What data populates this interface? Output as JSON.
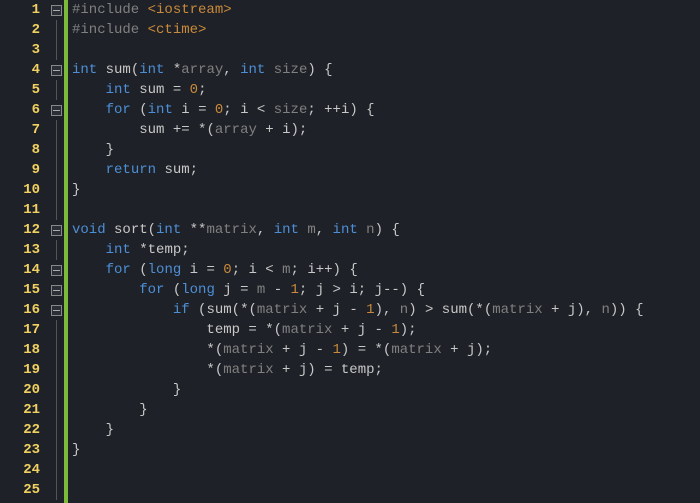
{
  "lines": {
    "l1": {
      "n": "1",
      "fold": true,
      "tokens": [
        [
          "pre",
          "#include "
        ],
        [
          "str",
          "<iostream>"
        ]
      ]
    },
    "l2": {
      "n": "2",
      "fold": false,
      "tokens": [
        [
          "pre",
          "#include "
        ],
        [
          "str",
          "<ctime>"
        ]
      ]
    },
    "l3": {
      "n": "3",
      "fold": false,
      "tokens": []
    },
    "l4": {
      "n": "4",
      "fold": true,
      "tokens": [
        [
          "typ",
          "int"
        ],
        [
          "op",
          " "
        ],
        [
          "id",
          "sum"
        ],
        [
          "op",
          "("
        ],
        [
          "typ",
          "int"
        ],
        [
          "op",
          " *"
        ],
        [
          "var",
          "array"
        ],
        [
          "op",
          ", "
        ],
        [
          "typ",
          "int"
        ],
        [
          "op",
          " "
        ],
        [
          "var",
          "size"
        ],
        [
          "op",
          ") {"
        ]
      ]
    },
    "l5": {
      "n": "5",
      "fold": false,
      "tokens": [
        [
          "op",
          "    "
        ],
        [
          "typ",
          "int"
        ],
        [
          "op",
          " "
        ],
        [
          "id",
          "sum"
        ],
        [
          "op",
          " = "
        ],
        [
          "num",
          "0"
        ],
        [
          "op",
          ";"
        ]
      ]
    },
    "l6": {
      "n": "6",
      "fold": true,
      "tokens": [
        [
          "op",
          "    "
        ],
        [
          "kw",
          "for"
        ],
        [
          "op",
          " ("
        ],
        [
          "typ",
          "int"
        ],
        [
          "op",
          " "
        ],
        [
          "id",
          "i"
        ],
        [
          "op",
          " = "
        ],
        [
          "num",
          "0"
        ],
        [
          "op",
          "; "
        ],
        [
          "id",
          "i"
        ],
        [
          "op",
          " < "
        ],
        [
          "var",
          "size"
        ],
        [
          "op",
          "; ++"
        ],
        [
          "id",
          "i"
        ],
        [
          "op",
          ") {"
        ]
      ]
    },
    "l7": {
      "n": "7",
      "fold": false,
      "tokens": [
        [
          "op",
          "        "
        ],
        [
          "id",
          "sum"
        ],
        [
          "op",
          " += *("
        ],
        [
          "var",
          "array"
        ],
        [
          "op",
          " + "
        ],
        [
          "id",
          "i"
        ],
        [
          "op",
          ");"
        ]
      ]
    },
    "l8": {
      "n": "8",
      "fold": false,
      "tokens": [
        [
          "op",
          "    }"
        ]
      ]
    },
    "l9": {
      "n": "9",
      "fold": false,
      "tokens": [
        [
          "op",
          "    "
        ],
        [
          "kw",
          "return"
        ],
        [
          "op",
          " "
        ],
        [
          "id",
          "sum"
        ],
        [
          "op",
          ";"
        ]
      ]
    },
    "l10": {
      "n": "10",
      "fold": false,
      "tokens": [
        [
          "op",
          "}"
        ]
      ]
    },
    "l11": {
      "n": "11",
      "fold": false,
      "tokens": []
    },
    "l12": {
      "n": "12",
      "fold": true,
      "tokens": [
        [
          "typ",
          "void"
        ],
        [
          "op",
          " "
        ],
        [
          "id",
          "sort"
        ],
        [
          "op",
          "("
        ],
        [
          "typ",
          "int"
        ],
        [
          "op",
          " **"
        ],
        [
          "var",
          "matrix"
        ],
        [
          "op",
          ", "
        ],
        [
          "typ",
          "int"
        ],
        [
          "op",
          " "
        ],
        [
          "var",
          "m"
        ],
        [
          "op",
          ", "
        ],
        [
          "typ",
          "int"
        ],
        [
          "op",
          " "
        ],
        [
          "var",
          "n"
        ],
        [
          "op",
          ") {"
        ]
      ]
    },
    "l13": {
      "n": "13",
      "fold": false,
      "tokens": [
        [
          "op",
          "    "
        ],
        [
          "typ",
          "int"
        ],
        [
          "op",
          " *"
        ],
        [
          "id",
          "temp"
        ],
        [
          "op",
          ";"
        ]
      ]
    },
    "l14": {
      "n": "14",
      "fold": true,
      "tokens": [
        [
          "op",
          "    "
        ],
        [
          "kw",
          "for"
        ],
        [
          "op",
          " ("
        ],
        [
          "typ",
          "long"
        ],
        [
          "op",
          " "
        ],
        [
          "id",
          "i"
        ],
        [
          "op",
          " = "
        ],
        [
          "num",
          "0"
        ],
        [
          "op",
          "; "
        ],
        [
          "id",
          "i"
        ],
        [
          "op",
          " < "
        ],
        [
          "var",
          "m"
        ],
        [
          "op",
          "; "
        ],
        [
          "id",
          "i"
        ],
        [
          "op",
          "++) {"
        ]
      ]
    },
    "l15": {
      "n": "15",
      "fold": true,
      "tokens": [
        [
          "op",
          "        "
        ],
        [
          "kw",
          "for"
        ],
        [
          "op",
          " ("
        ],
        [
          "typ",
          "long"
        ],
        [
          "op",
          " "
        ],
        [
          "id",
          "j"
        ],
        [
          "op",
          " = "
        ],
        [
          "var",
          "m"
        ],
        [
          "op",
          " - "
        ],
        [
          "num",
          "1"
        ],
        [
          "op",
          "; "
        ],
        [
          "id",
          "j"
        ],
        [
          "op",
          " > "
        ],
        [
          "id",
          "i"
        ],
        [
          "op",
          "; "
        ],
        [
          "id",
          "j"
        ],
        [
          "op",
          "--) {"
        ]
      ]
    },
    "l16": {
      "n": "16",
      "fold": true,
      "tokens": [
        [
          "op",
          "            "
        ],
        [
          "kw",
          "if"
        ],
        [
          "op",
          " ("
        ],
        [
          "id",
          "sum"
        ],
        [
          "op",
          "(*("
        ],
        [
          "var",
          "matrix"
        ],
        [
          "op",
          " + "
        ],
        [
          "id",
          "j"
        ],
        [
          "op",
          " - "
        ],
        [
          "num",
          "1"
        ],
        [
          "op",
          "), "
        ],
        [
          "var",
          "n"
        ],
        [
          "op",
          ") > "
        ],
        [
          "id",
          "sum"
        ],
        [
          "op",
          "(*("
        ],
        [
          "var",
          "matrix"
        ],
        [
          "op",
          " + "
        ],
        [
          "id",
          "j"
        ],
        [
          "op",
          "), "
        ],
        [
          "var",
          "n"
        ],
        [
          "op",
          ")) {"
        ]
      ]
    },
    "l17": {
      "n": "17",
      "fold": false,
      "tokens": [
        [
          "op",
          "                "
        ],
        [
          "id",
          "temp"
        ],
        [
          "op",
          " = *("
        ],
        [
          "var",
          "matrix"
        ],
        [
          "op",
          " + "
        ],
        [
          "id",
          "j"
        ],
        [
          "op",
          " - "
        ],
        [
          "num",
          "1"
        ],
        [
          "op",
          ");"
        ]
      ]
    },
    "l18": {
      "n": "18",
      "fold": false,
      "tokens": [
        [
          "op",
          "                *("
        ],
        [
          "var",
          "matrix"
        ],
        [
          "op",
          " + "
        ],
        [
          "id",
          "j"
        ],
        [
          "op",
          " - "
        ],
        [
          "num",
          "1"
        ],
        [
          "op",
          ") = *("
        ],
        [
          "var",
          "matrix"
        ],
        [
          "op",
          " + "
        ],
        [
          "id",
          "j"
        ],
        [
          "op",
          ");"
        ]
      ]
    },
    "l19": {
      "n": "19",
      "fold": false,
      "tokens": [
        [
          "op",
          "                *("
        ],
        [
          "var",
          "matrix"
        ],
        [
          "op",
          " + "
        ],
        [
          "id",
          "j"
        ],
        [
          "op",
          ") = "
        ],
        [
          "id",
          "temp"
        ],
        [
          "op",
          ";"
        ]
      ]
    },
    "l20": {
      "n": "20",
      "fold": false,
      "tokens": [
        [
          "op",
          "            }"
        ]
      ]
    },
    "l21": {
      "n": "21",
      "fold": false,
      "tokens": [
        [
          "op",
          "        }"
        ]
      ]
    },
    "l22": {
      "n": "22",
      "fold": false,
      "tokens": [
        [
          "op",
          "    }"
        ]
      ]
    },
    "l23": {
      "n": "23",
      "fold": false,
      "tokens": [
        [
          "op",
          "}"
        ]
      ]
    },
    "l24": {
      "n": "24",
      "fold": false,
      "tokens": []
    },
    "l25": {
      "n": "25",
      "fold": false,
      "tokens": []
    }
  },
  "order": [
    "l1",
    "l2",
    "l3",
    "l4",
    "l5",
    "l6",
    "l7",
    "l8",
    "l9",
    "l10",
    "l11",
    "l12",
    "l13",
    "l14",
    "l15",
    "l16",
    "l17",
    "l18",
    "l19",
    "l20",
    "l21",
    "l22",
    "l23",
    "l24",
    "l25"
  ],
  "marker_through": 25
}
